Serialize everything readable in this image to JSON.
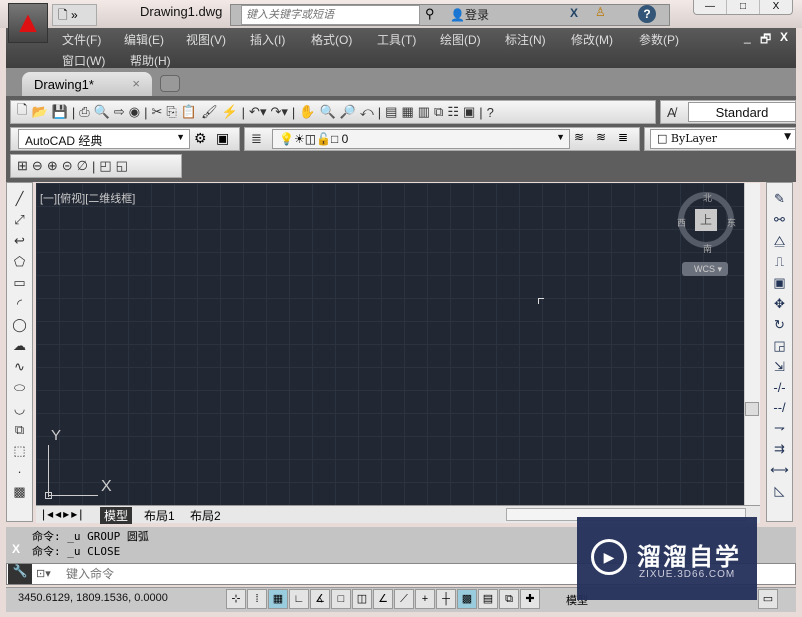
{
  "title_bar": {
    "logo": "A",
    "doc_title": "Drawing1.dwg",
    "search_placeholder": "键入关键字或短语",
    "login": "登录",
    "qa_icon": "new-file-icon",
    "window_buttons": [
      "—",
      "□",
      "X"
    ]
  },
  "menu": {
    "items": [
      "文件(F)",
      "编辑(E)",
      "视图(V)",
      "插入(I)",
      "格式(O)",
      "工具(T)",
      "绘图(D)",
      "标注(N)",
      "修改(M)",
      "参数(P)",
      "窗口(W)",
      "帮助(H)"
    ],
    "doc_controls": [
      "_",
      "🗗",
      "X"
    ]
  },
  "tabs": {
    "active": "Drawing1*",
    "close": "×"
  },
  "toolbars": {
    "text_style": "Standard",
    "workspace": "AutoCAD 经典",
    "layer": "0",
    "color": "ByLayer"
  },
  "viewport": {
    "label": "[一][俯视][二维线框]",
    "viewcube": {
      "top": "上",
      "north": "北",
      "south": "南",
      "east": "东",
      "west": "西"
    },
    "wcs": "WCS",
    "ucs_x": "X",
    "ucs_y": "Y"
  },
  "layout_tabs": [
    "模型",
    "布局1",
    "布局2"
  ],
  "command": {
    "lines": [
      "命令: _u GROUP 圆弧",
      "命令: _u CLOSE"
    ],
    "placeholder": "键入命令"
  },
  "status": {
    "coords": "3450.6129, 1809.1536, 0.0000",
    "model": "模型"
  },
  "watermark": {
    "title": "溜溜自学",
    "url": "ZIXUE.3D66.COM"
  }
}
